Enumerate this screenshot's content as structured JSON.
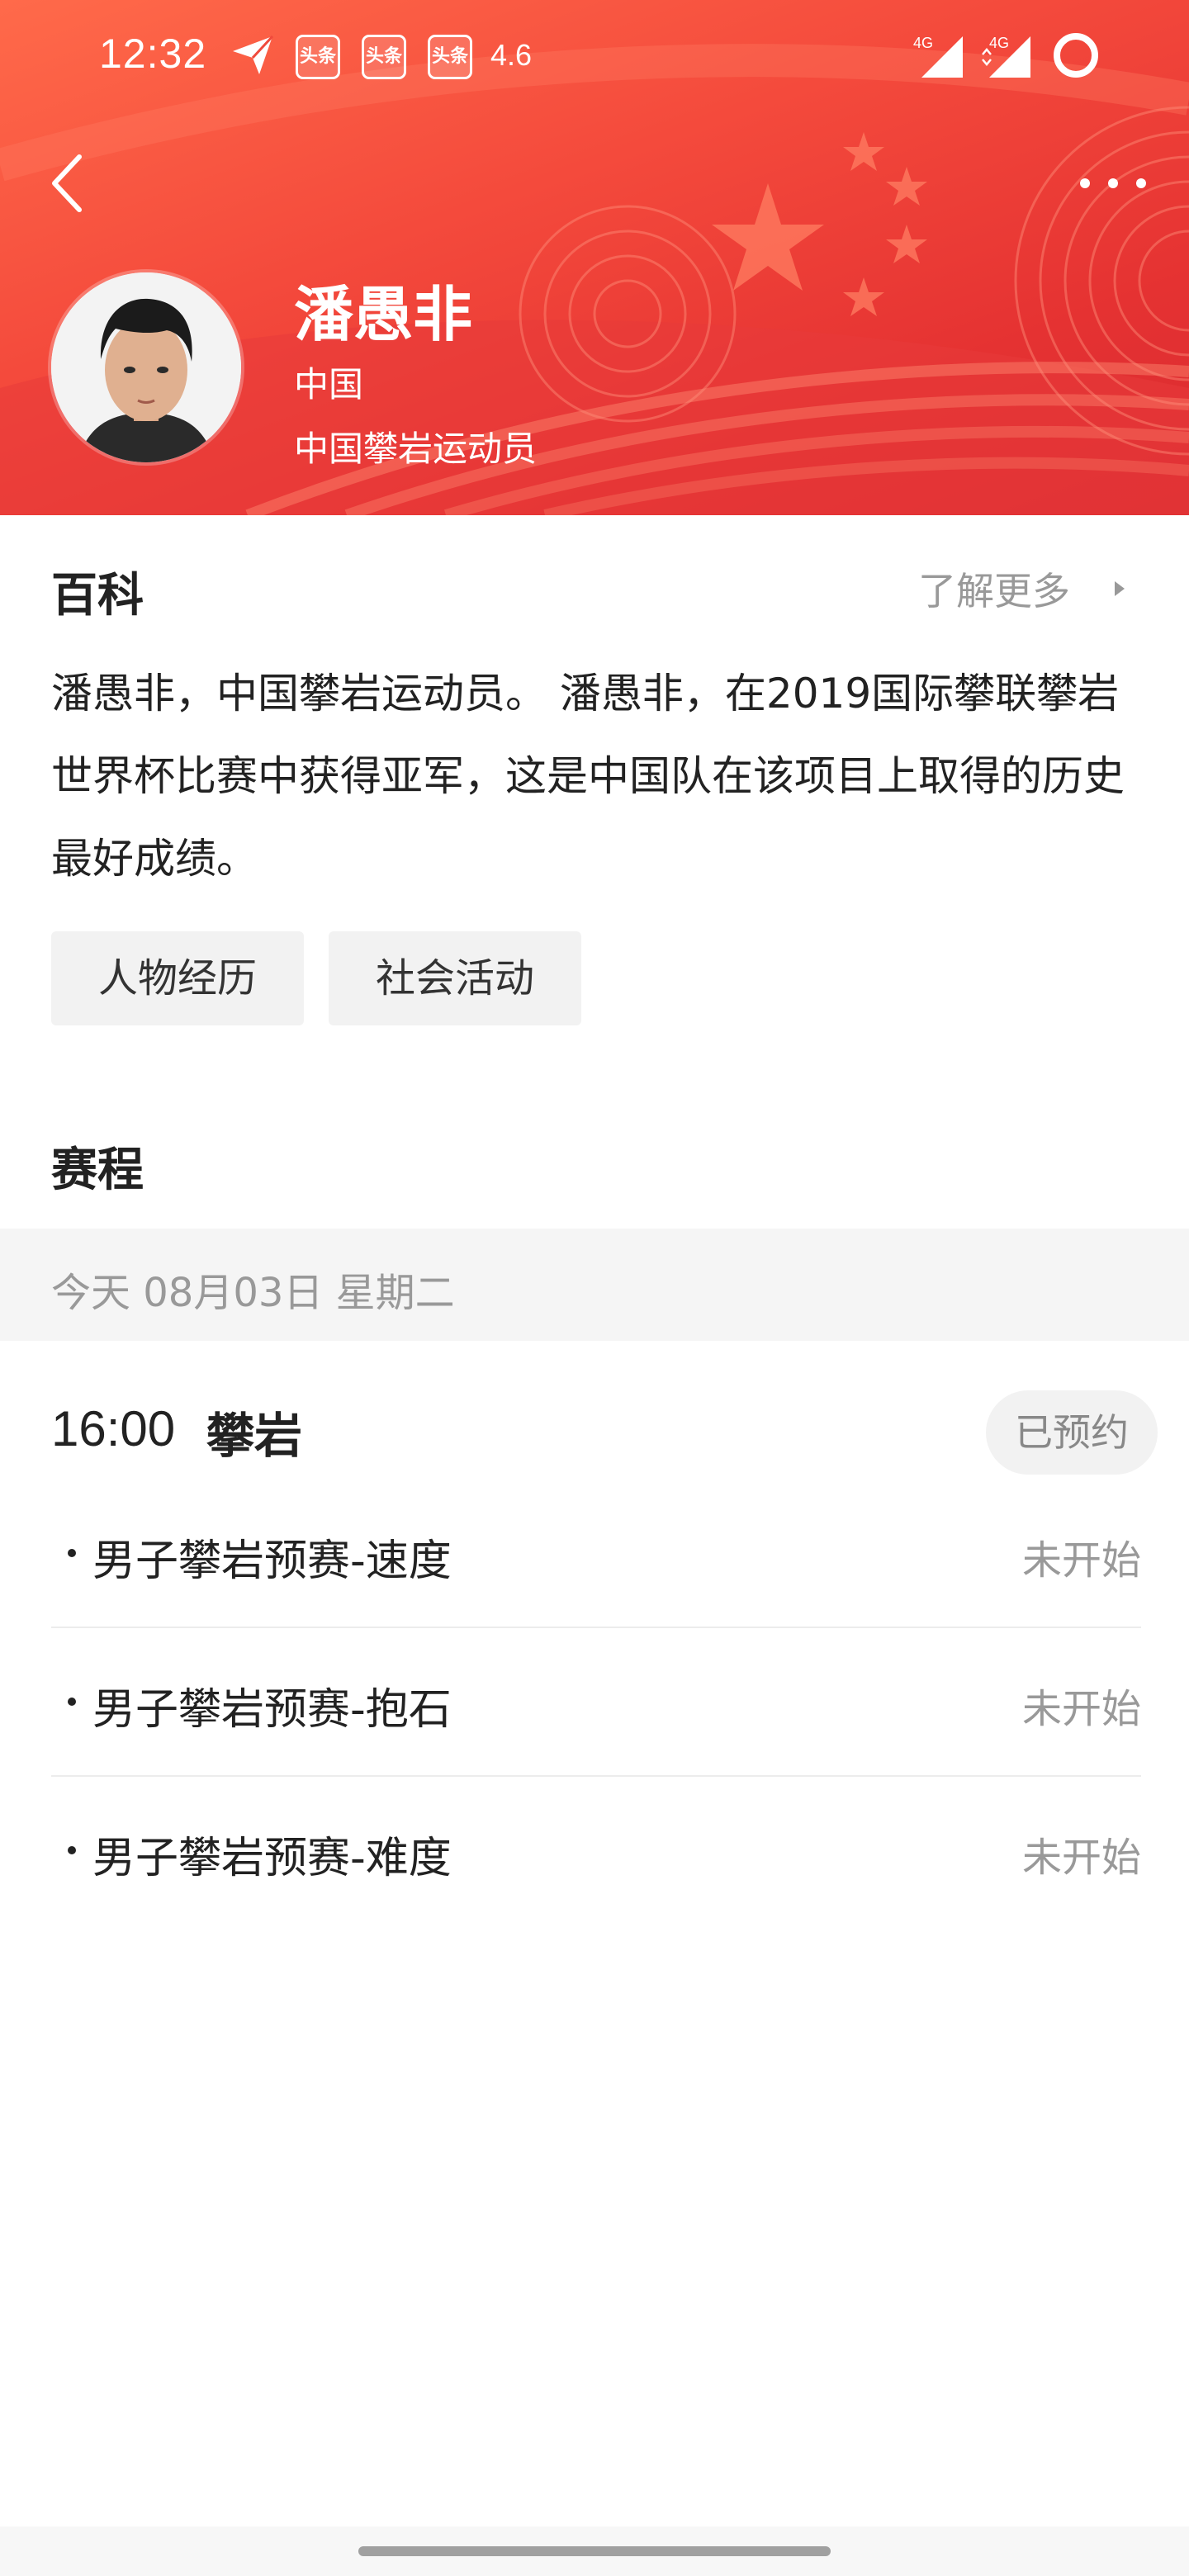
{
  "status_bar": {
    "time": "12:32",
    "app_badges": [
      "头条",
      "头条",
      "头条"
    ],
    "network_speed": "4.6",
    "signal_labels": [
      "4G",
      "4G"
    ]
  },
  "profile": {
    "name": "潘愚非",
    "country": "中国",
    "role": "中国攀岩运动员"
  },
  "baike": {
    "title": "百科",
    "more_label": "了解更多",
    "intro": "潘愚非，中国攀岩运动员。 潘愚非，在2019国际攀联攀岩世界杯比赛中获得亚军，这是中国队在该项目上取得的历史最好成绩。",
    "tags": [
      "人物经历",
      "社会活动"
    ]
  },
  "schedule": {
    "title": "赛程",
    "date_label": "今天  08月03日  星期二",
    "event": {
      "time": "16:00",
      "name": "攀岩",
      "reserve_label": "已预约",
      "items": [
        {
          "label": "男子攀岩预赛-速度",
          "status": "未开始"
        },
        {
          "label": "男子攀岩预赛-抱石",
          "status": "未开始"
        },
        {
          "label": "男子攀岩预赛-难度",
          "status": "未开始"
        }
      ]
    }
  },
  "colors": {
    "header_red": "#e53232",
    "header_orange": "#ff6a4a",
    "muted_text": "#999999",
    "chip_bg": "#f2f2f2"
  },
  "icons": [
    "back-arrow-icon",
    "more-dots-icon",
    "send-plane-icon",
    "signal-icon",
    "status-circle-icon",
    "chevron-right-icon"
  ]
}
